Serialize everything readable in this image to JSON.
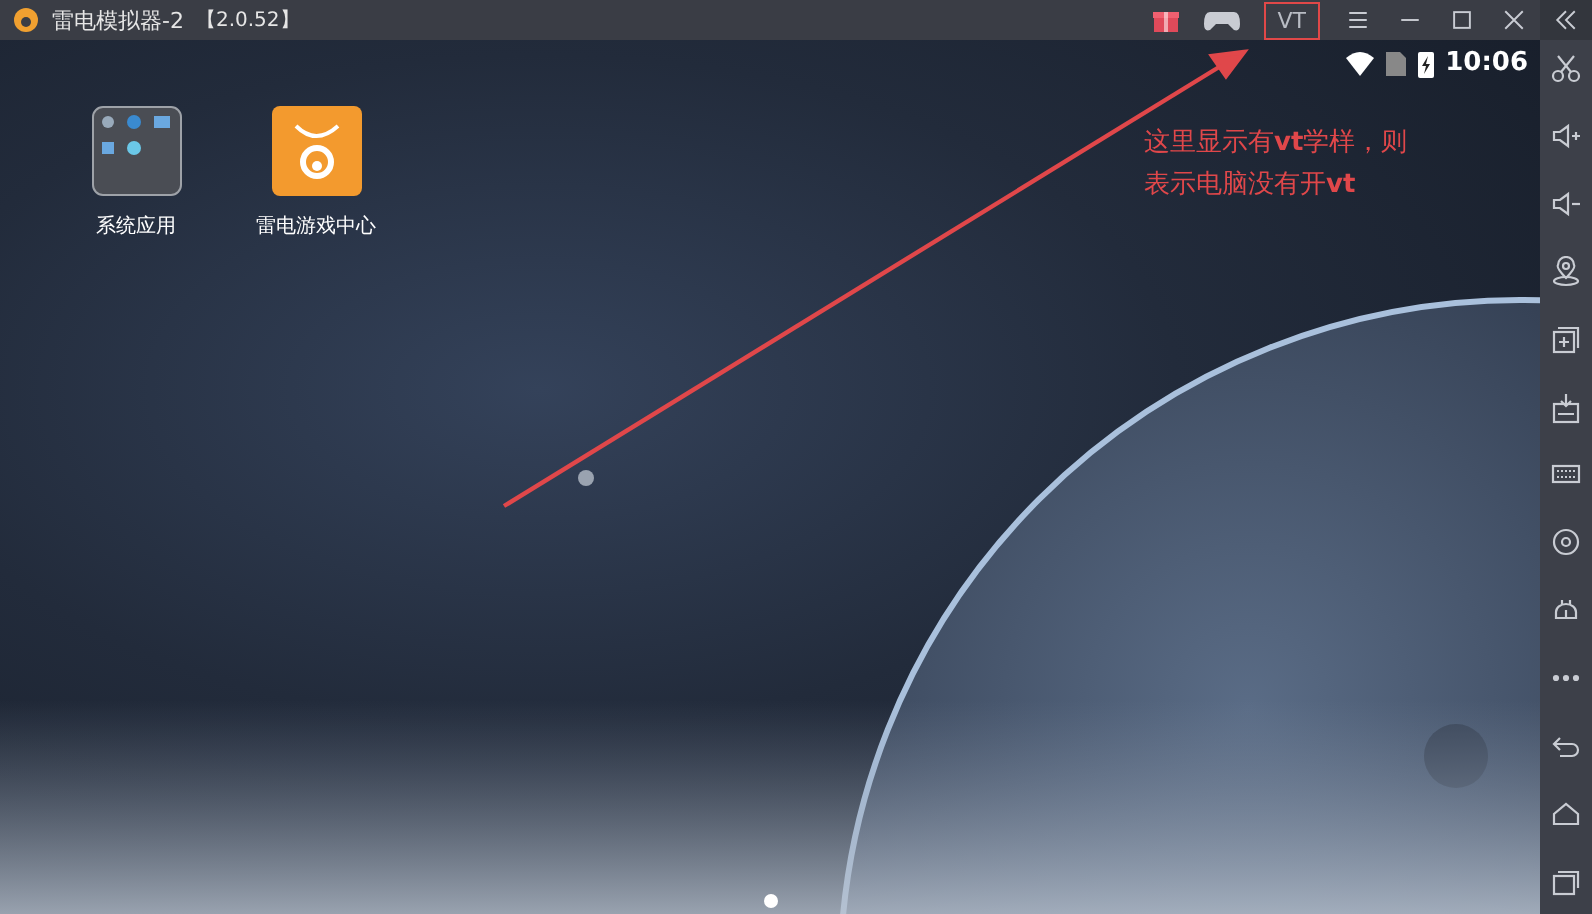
{
  "window": {
    "title": "雷电模拟器-2",
    "version": "【2.0.52】"
  },
  "toolbar": {
    "vt": {
      "label": "VT",
      "highlighted": true
    }
  },
  "status_bar": {
    "time": "10:06"
  },
  "desktop": [
    {
      "kind": "folder",
      "label": "系统应用"
    },
    {
      "kind": "store",
      "label": "雷电游戏中心"
    }
  ],
  "annotation": {
    "lines": [
      "这里显示有**vt**学样，则",
      "表示电脑没有开**vt**"
    ]
  },
  "pages": [
    {
      "selected": true
    }
  ]
}
